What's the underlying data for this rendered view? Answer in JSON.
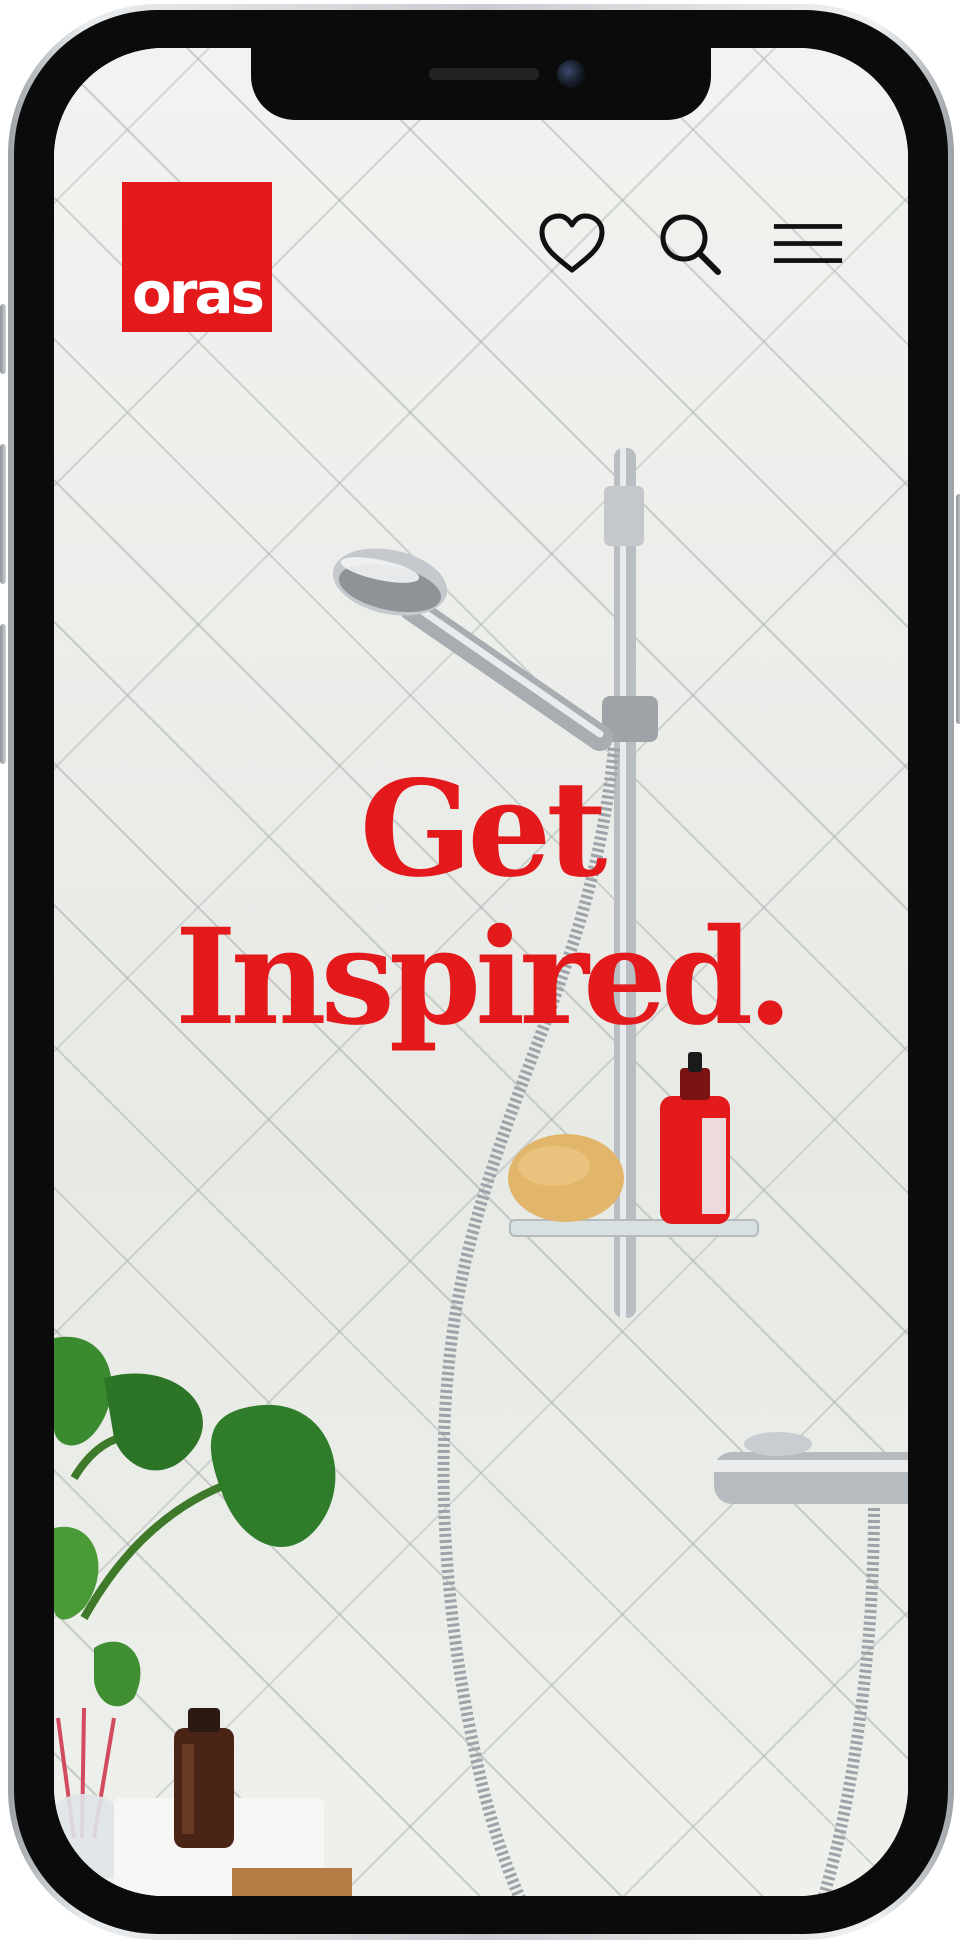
{
  "brand": {
    "logo_text": "oras",
    "logo_color": "#e3191b"
  },
  "header": {
    "icons": [
      {
        "name": "favorites",
        "icon": "heart-icon"
      },
      {
        "name": "search",
        "icon": "search-icon"
      },
      {
        "name": "menu",
        "icon": "hamburger-menu-icon"
      }
    ]
  },
  "hero": {
    "headline_line1": "Get",
    "headline_line2": "Inspired.",
    "headline_color": "#e3191b"
  }
}
